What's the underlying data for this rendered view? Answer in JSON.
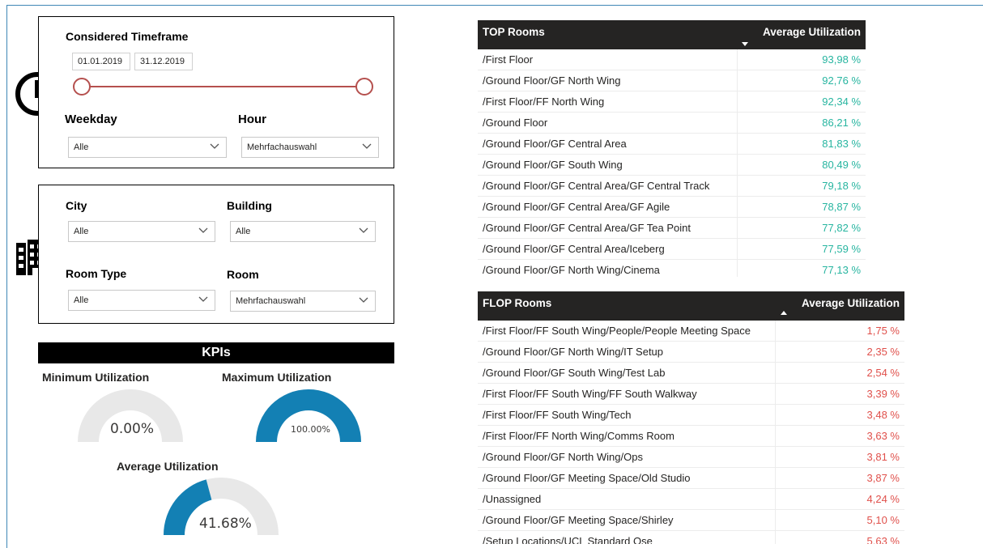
{
  "timeframe": {
    "title": "Considered Timeframe",
    "start_date": "01.01.2019",
    "end_date": "31.12.2019"
  },
  "weekday": {
    "label": "Weekday",
    "value": "Alle"
  },
  "hour": {
    "label": "Hour",
    "value": "Mehrfachauswahl"
  },
  "city": {
    "label": "City",
    "value": "Alle"
  },
  "building": {
    "label": "Building",
    "value": "Alle"
  },
  "room_type": {
    "label": "Room Type",
    "value": "Alle"
  },
  "room": {
    "label": "Room",
    "value": "Mehrfachauswahl"
  },
  "kpis": {
    "title": "KPIs",
    "min": {
      "label": "Minimum Utilization",
      "value_text": "0.00%",
      "fraction": 0.0
    },
    "max": {
      "label": "Maximum Utilization",
      "value_text": "100.00%",
      "fraction": 1.0
    },
    "avg": {
      "label": "Average Utilization",
      "value_text": "41.68%",
      "fraction": 0.4168
    }
  },
  "colors": {
    "gauge_fill": "#1380b4",
    "gauge_track": "#e8e8e8",
    "slider": "#b5504e",
    "top_value": "#27b5a0",
    "flop_value": "#e0504b",
    "header_bg": "#252423"
  },
  "top_table": {
    "col1": "TOP Rooms",
    "col2": "Average Utilization",
    "rows": [
      [
        "/First Floor",
        "93,98 %"
      ],
      [
        "/Ground Floor/GF North Wing",
        "92,76 %"
      ],
      [
        "/First Floor/FF North Wing",
        "92,34 %"
      ],
      [
        "/Ground Floor",
        "86,21 %"
      ],
      [
        "/Ground Floor/GF Central Area",
        "81,83 %"
      ],
      [
        "/Ground Floor/GF South Wing",
        "80,49 %"
      ],
      [
        "/Ground Floor/GF Central Area/GF Central Track",
        "79,18 %"
      ],
      [
        "/Ground Floor/GF Central Area/GF Agile",
        "78,87 %"
      ],
      [
        "/Ground Floor/GF Central Area/GF Tea Point",
        "77,82 %"
      ],
      [
        "/Ground Floor/GF Central Area/Iceberg",
        "77,59 %"
      ],
      [
        "/Ground Floor/GF North Wing/Cinema",
        "77,13 %"
      ]
    ]
  },
  "flop_table": {
    "col1": "FLOP Rooms",
    "col2": "Average Utilization",
    "rows": [
      [
        "/First Floor/FF South Wing/People/People Meeting Space",
        "1,75 %"
      ],
      [
        "/Ground Floor/GF North Wing/IT Setup",
        "2,35 %"
      ],
      [
        "/Ground Floor/GF South Wing/Test Lab",
        "2,54 %"
      ],
      [
        "/First Floor/FF South Wing/FF South Walkway",
        "3,39 %"
      ],
      [
        "/First Floor/FF South Wing/Tech",
        "3,48 %"
      ],
      [
        "/First Floor/FF North Wing/Comms Room",
        "3,63 %"
      ],
      [
        "/Ground Floor/GF North Wing/Ops",
        "3,81 %"
      ],
      [
        "/Ground Floor/GF Meeting Space/Old Studio",
        "3,87 %"
      ],
      [
        "/Unassigned",
        "4,24 %"
      ],
      [
        "/Ground Floor/GF Meeting Space/Shirley",
        "5,10 %"
      ],
      [
        "/Setup Locations/UCL Standard Ose",
        "5,63 %"
      ]
    ]
  }
}
